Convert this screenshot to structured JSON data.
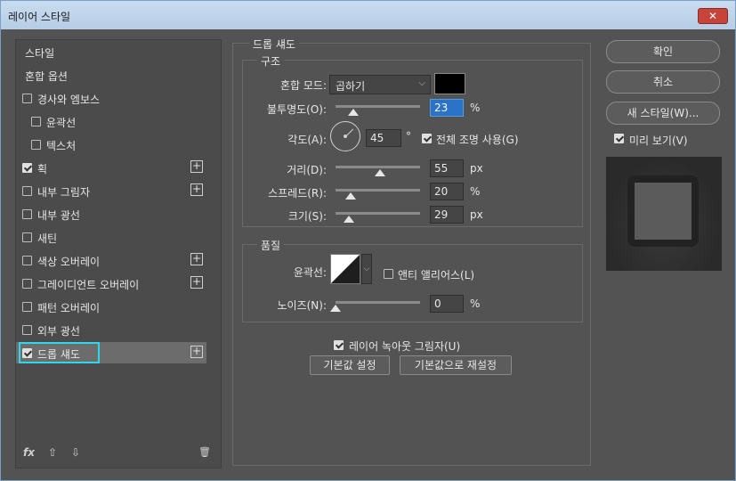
{
  "window": {
    "title": "레이어 스타일",
    "close": "✕"
  },
  "styles": {
    "items": [
      {
        "label": "스타일",
        "checkbox": false,
        "checked": false,
        "plus": false
      },
      {
        "label": "혼합 옵션",
        "checkbox": false,
        "checked": false,
        "plus": false
      },
      {
        "label": "경사와 엠보스",
        "checkbox": true,
        "checked": false,
        "plus": false
      },
      {
        "label": "윤곽선",
        "checkbox": true,
        "checked": false,
        "plus": false,
        "indent": true
      },
      {
        "label": "텍스처",
        "checkbox": true,
        "checked": false,
        "plus": false,
        "indent": true
      },
      {
        "label": "획",
        "checkbox": true,
        "checked": true,
        "plus": true
      },
      {
        "label": "내부 그림자",
        "checkbox": true,
        "checked": false,
        "plus": true
      },
      {
        "label": "내부 광선",
        "checkbox": true,
        "checked": false,
        "plus": false
      },
      {
        "label": "새틴",
        "checkbox": true,
        "checked": false,
        "plus": false
      },
      {
        "label": "색상 오버레이",
        "checkbox": true,
        "checked": false,
        "plus": true
      },
      {
        "label": "그레이디언트 오버레이",
        "checkbox": true,
        "checked": false,
        "plus": true
      },
      {
        "label": "패턴 오버레이",
        "checkbox": true,
        "checked": false,
        "plus": false
      },
      {
        "label": "외부 광선",
        "checkbox": true,
        "checked": false,
        "plus": false
      },
      {
        "label": "드롭 섀도",
        "checkbox": true,
        "checked": true,
        "plus": true,
        "selected": true
      }
    ],
    "footer": {
      "fx": "fx",
      "up": "⇧",
      "down": "⇩",
      "trash": "🗑"
    }
  },
  "drop_shadow": {
    "title": "드롭 섀도",
    "structure": {
      "title": "구조",
      "blend_mode_label": "혼합 모드:",
      "blend_mode_value": "곱하기",
      "blend_color": "#000000",
      "opacity_label": "불투명도(O):",
      "opacity": "23",
      "opacity_unit": "%",
      "angle_label": "각도(A):",
      "angle": "45",
      "angle_unit": "°",
      "global_light_label": "전체 조명 사용(G)",
      "global_light": true,
      "distance_label": "거리(D):",
      "distance": "55",
      "distance_unit": "px",
      "spread_label": "스프레드(R):",
      "spread": "20",
      "spread_unit": "%",
      "size_label": "크기(S):",
      "size": "29",
      "size_unit": "px"
    },
    "quality": {
      "title": "품질",
      "contour_label": "윤곽선:",
      "antialias_label": "앤티 앨리어스(L)",
      "antialias": false,
      "noise_label": "노이즈(N):",
      "noise": "0",
      "noise_unit": "%"
    },
    "knockout_label": "레이어 녹아웃 그림자(U)",
    "knockout": true,
    "make_default": "기본값 설정",
    "reset_default": "기본값으로 재설정"
  },
  "actions": {
    "ok": "확인",
    "cancel": "취소",
    "new_style": "새 스타일(W)...",
    "preview_label": "미리 보기(V)",
    "preview": true
  },
  "colors": {
    "accent_selection": "#2fd6f0",
    "focused_input": "#2b73c8"
  }
}
